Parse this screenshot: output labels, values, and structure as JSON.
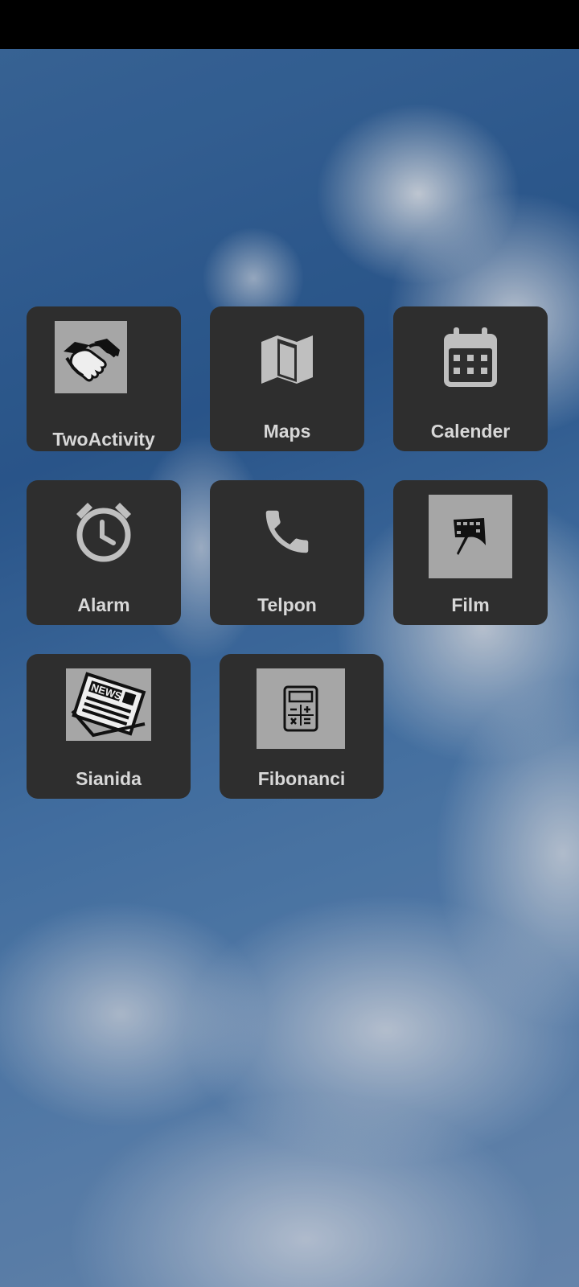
{
  "apps": [
    {
      "label": "TwoActivity",
      "icon": "handshake-icon"
    },
    {
      "label": "Maps",
      "icon": "map-icon"
    },
    {
      "label": "Calender",
      "icon": "calendar-icon"
    },
    {
      "label": "Alarm",
      "icon": "alarm-clock-icon"
    },
    {
      "label": "Telpon",
      "icon": "phone-icon"
    },
    {
      "label": "Film",
      "icon": "film-icon"
    },
    {
      "label": "Sianida",
      "icon": "newspaper-icon"
    },
    {
      "label": "Fibonanci",
      "icon": "calculator-icon"
    }
  ],
  "colors": {
    "tile": "#2e2e2e",
    "label": "#d8d8d8",
    "icon_box": "#a6a6a6",
    "status_bar": "#000000"
  }
}
